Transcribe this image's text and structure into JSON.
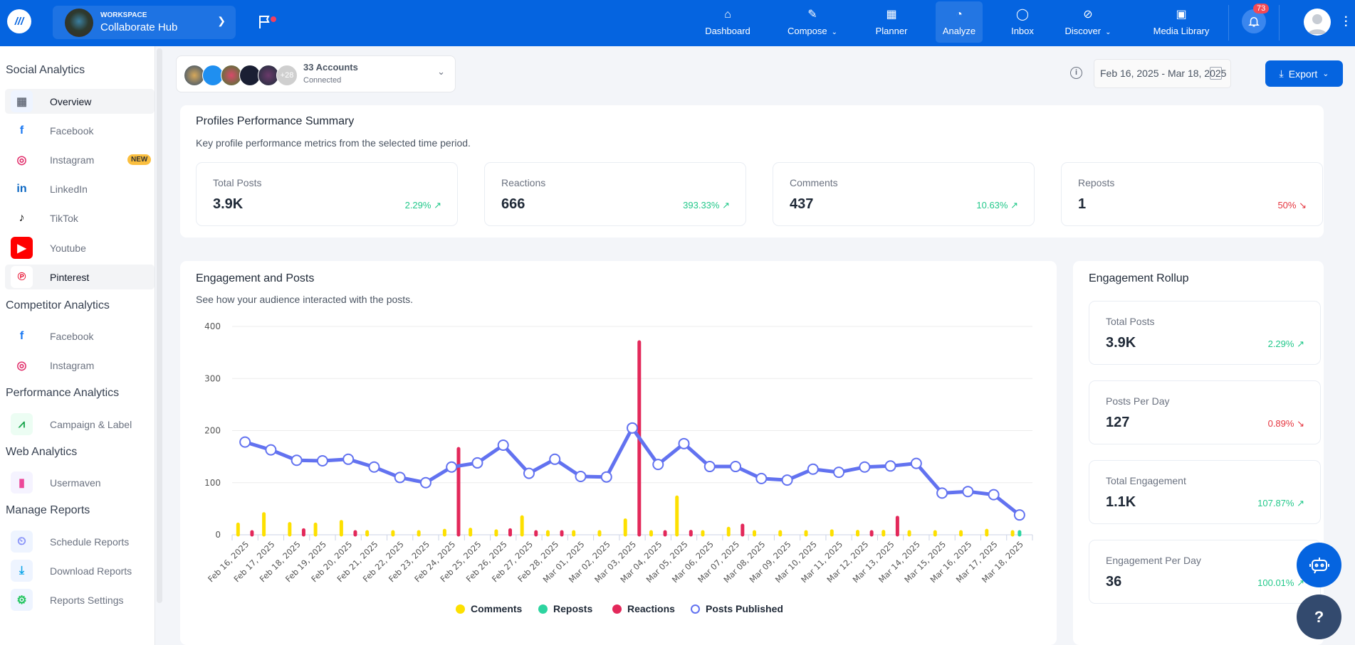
{
  "topbar": {
    "workspace_label": "WORKSPACE",
    "workspace_name": "Collaborate Hub",
    "nav": [
      {
        "label": "Dashboard",
        "icon": "home-icon"
      },
      {
        "label": "Compose",
        "icon": "pencil-icon",
        "dropdown": true
      },
      {
        "label": "Planner",
        "icon": "calendar-icon"
      },
      {
        "label": "Analyze",
        "icon": "analytics-icon",
        "active": true
      },
      {
        "label": "Inbox",
        "icon": "chat-icon"
      },
      {
        "label": "Discover",
        "icon": "compass-icon",
        "dropdown": true
      },
      {
        "label": "Media Library",
        "icon": "images-icon"
      }
    ],
    "notifications": "73"
  },
  "sidebar": {
    "sections": [
      {
        "title": "Social Analytics",
        "items": [
          "Overview",
          "Facebook",
          "Instagram",
          "LinkedIn",
          "TikTok",
          "Youtube",
          "Pinterest"
        ]
      },
      {
        "title": "Competitor Analytics",
        "items": [
          "Facebook",
          "Instagram"
        ]
      },
      {
        "title": "Performance Analytics",
        "items": [
          "Campaign & Label"
        ]
      },
      {
        "title": "Web Analytics",
        "items": [
          "Usermaven"
        ]
      },
      {
        "title": "Manage Reports",
        "items": [
          "Schedule Reports",
          "Download Reports",
          "Reports Settings"
        ]
      }
    ],
    "new_badge": "NEW"
  },
  "toolbar": {
    "accounts_count": "33 Accounts",
    "accounts_status": "Connected",
    "more_accounts": "+28",
    "date_range": "Feb 16, 2025 - Mar 18, 2025",
    "export_label": "Export"
  },
  "summary": {
    "title": "Profiles Performance Summary",
    "subtitle": "Key profile performance metrics from the selected time period.",
    "cards": [
      {
        "label": "Total Posts",
        "value": "3.9K",
        "change": "2.29%",
        "trend": "up"
      },
      {
        "label": "Reactions",
        "value": "666",
        "change": "393.33%",
        "trend": "up"
      },
      {
        "label": "Comments",
        "value": "437",
        "change": "10.63%",
        "trend": "up"
      },
      {
        "label": "Reposts",
        "value": "1",
        "change": "50%",
        "trend": "down"
      }
    ]
  },
  "engagement": {
    "title": "Engagement and Posts",
    "subtitle": "See how your audience interacted with the posts."
  },
  "rollup": {
    "title": "Engagement Rollup",
    "cards": [
      {
        "label": "Total Posts",
        "value": "3.9K",
        "change": "2.29%",
        "trend": "up"
      },
      {
        "label": "Posts Per Day",
        "value": "127",
        "change": "0.89%",
        "trend": "down"
      },
      {
        "label": "Total Engagement",
        "value": "1.1K",
        "change": "107.87%",
        "trend": "up"
      },
      {
        "label": "Engagement Per Day",
        "value": "36",
        "change": "100.01%",
        "trend": "up"
      }
    ]
  },
  "colors": {
    "brand": "#0564e0",
    "comments": "#fde000",
    "reposts": "#2dd4a0",
    "reactions": "#e3285a",
    "posts": "#6272f0"
  },
  "chart_data": {
    "type": "bar",
    "title": "Engagement and Posts",
    "xlabel": "",
    "ylabel": "",
    "ylim": [
      0,
      400
    ],
    "yticks": [
      0,
      100,
      200,
      300,
      400
    ],
    "grid": true,
    "legend": "bottom",
    "categories": [
      "Feb 16, 2025",
      "Feb 17, 2025",
      "Feb 18, 2025",
      "Feb 19, 2025",
      "Feb 20, 2025",
      "Feb 21, 2025",
      "Feb 22, 2025",
      "Feb 23, 2025",
      "Feb 24, 2025",
      "Feb 25, 2025",
      "Feb 26, 2025",
      "Feb 27, 2025",
      "Feb 28, 2025",
      "Mar 01, 2025",
      "Mar 02, 2025",
      "Mar 03, 2025",
      "Mar 04, 2025",
      "Mar 05, 2025",
      "Mar 06, 2025",
      "Mar 07, 2025",
      "Mar 08, 2025",
      "Mar 09, 2025",
      "Mar 10, 2025",
      "Mar 11, 2025",
      "Mar 12, 2025",
      "Mar 13, 2025",
      "Mar 14, 2025",
      "Mar 15, 2025",
      "Mar 16, 2025",
      "Mar 17, 2025",
      "Mar 18, 2025"
    ],
    "series": [
      {
        "name": "Comments",
        "type": "bar",
        "values": [
          20,
          40,
          21,
          20,
          25,
          4,
          2,
          4,
          8,
          10,
          7,
          34,
          5,
          4,
          3,
          28,
          5,
          72,
          5,
          12,
          4,
          4,
          4,
          7,
          6,
          6,
          4,
          4,
          3,
          8,
          2
        ]
      },
      {
        "name": "Reposts",
        "type": "bar",
        "values": [
          0,
          0,
          0,
          0,
          0,
          0,
          0,
          0,
          0,
          0,
          0,
          0,
          0,
          0,
          0,
          0,
          0,
          0,
          0,
          0,
          0,
          0,
          0,
          0,
          0,
          0,
          0,
          0,
          0,
          0,
          1
        ]
      },
      {
        "name": "Reactions",
        "type": "bar",
        "values": [
          2,
          0,
          9,
          0,
          2,
          0,
          0,
          0,
          165,
          0,
          9,
          4,
          2,
          0,
          0,
          370,
          4,
          6,
          0,
          18,
          0,
          0,
          0,
          0,
          2,
          33,
          0,
          0,
          0,
          0,
          0
        ]
      },
      {
        "name": "Posts Published",
        "type": "line",
        "values": [
          178,
          163,
          143,
          142,
          145,
          130,
          110,
          100,
          130,
          138,
          172,
          118,
          145,
          112,
          111,
          205,
          135,
          175,
          131,
          131,
          108,
          105,
          126,
          120,
          130,
          132,
          137,
          80,
          83,
          77,
          38
        ]
      }
    ]
  }
}
